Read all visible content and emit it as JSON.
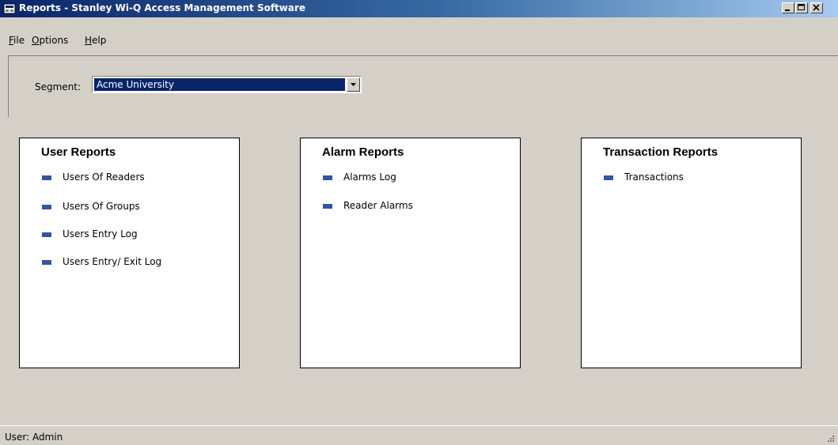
{
  "window": {
    "title": "Reports - Stanley Wi-Q Access Management Software"
  },
  "menu": {
    "file": {
      "first": "F",
      "rest": "ile"
    },
    "options": {
      "first": "O",
      "rest": "ptions"
    },
    "help": {
      "first": "H",
      "rest": "elp"
    }
  },
  "segment": {
    "label": "Segment:",
    "value": "Acme University"
  },
  "panels": {
    "user": {
      "title": "User Reports",
      "items": [
        "Users Of Readers",
        "Users Of Groups",
        "Users Entry Log",
        "Users Entry/ Exit Log"
      ]
    },
    "alarm": {
      "title": "Alarm Reports",
      "items": [
        "Alarms Log",
        "Reader Alarms"
      ]
    },
    "transaction": {
      "title": "Transaction Reports",
      "items": [
        "Transactions"
      ]
    }
  },
  "status": {
    "text": "User: Admin"
  },
  "colors": {
    "title_bar_start": "#0a246a",
    "title_bar_end": "#a6caf0",
    "bullet": "#3355a0",
    "window_bg": "#d4d0c8"
  }
}
